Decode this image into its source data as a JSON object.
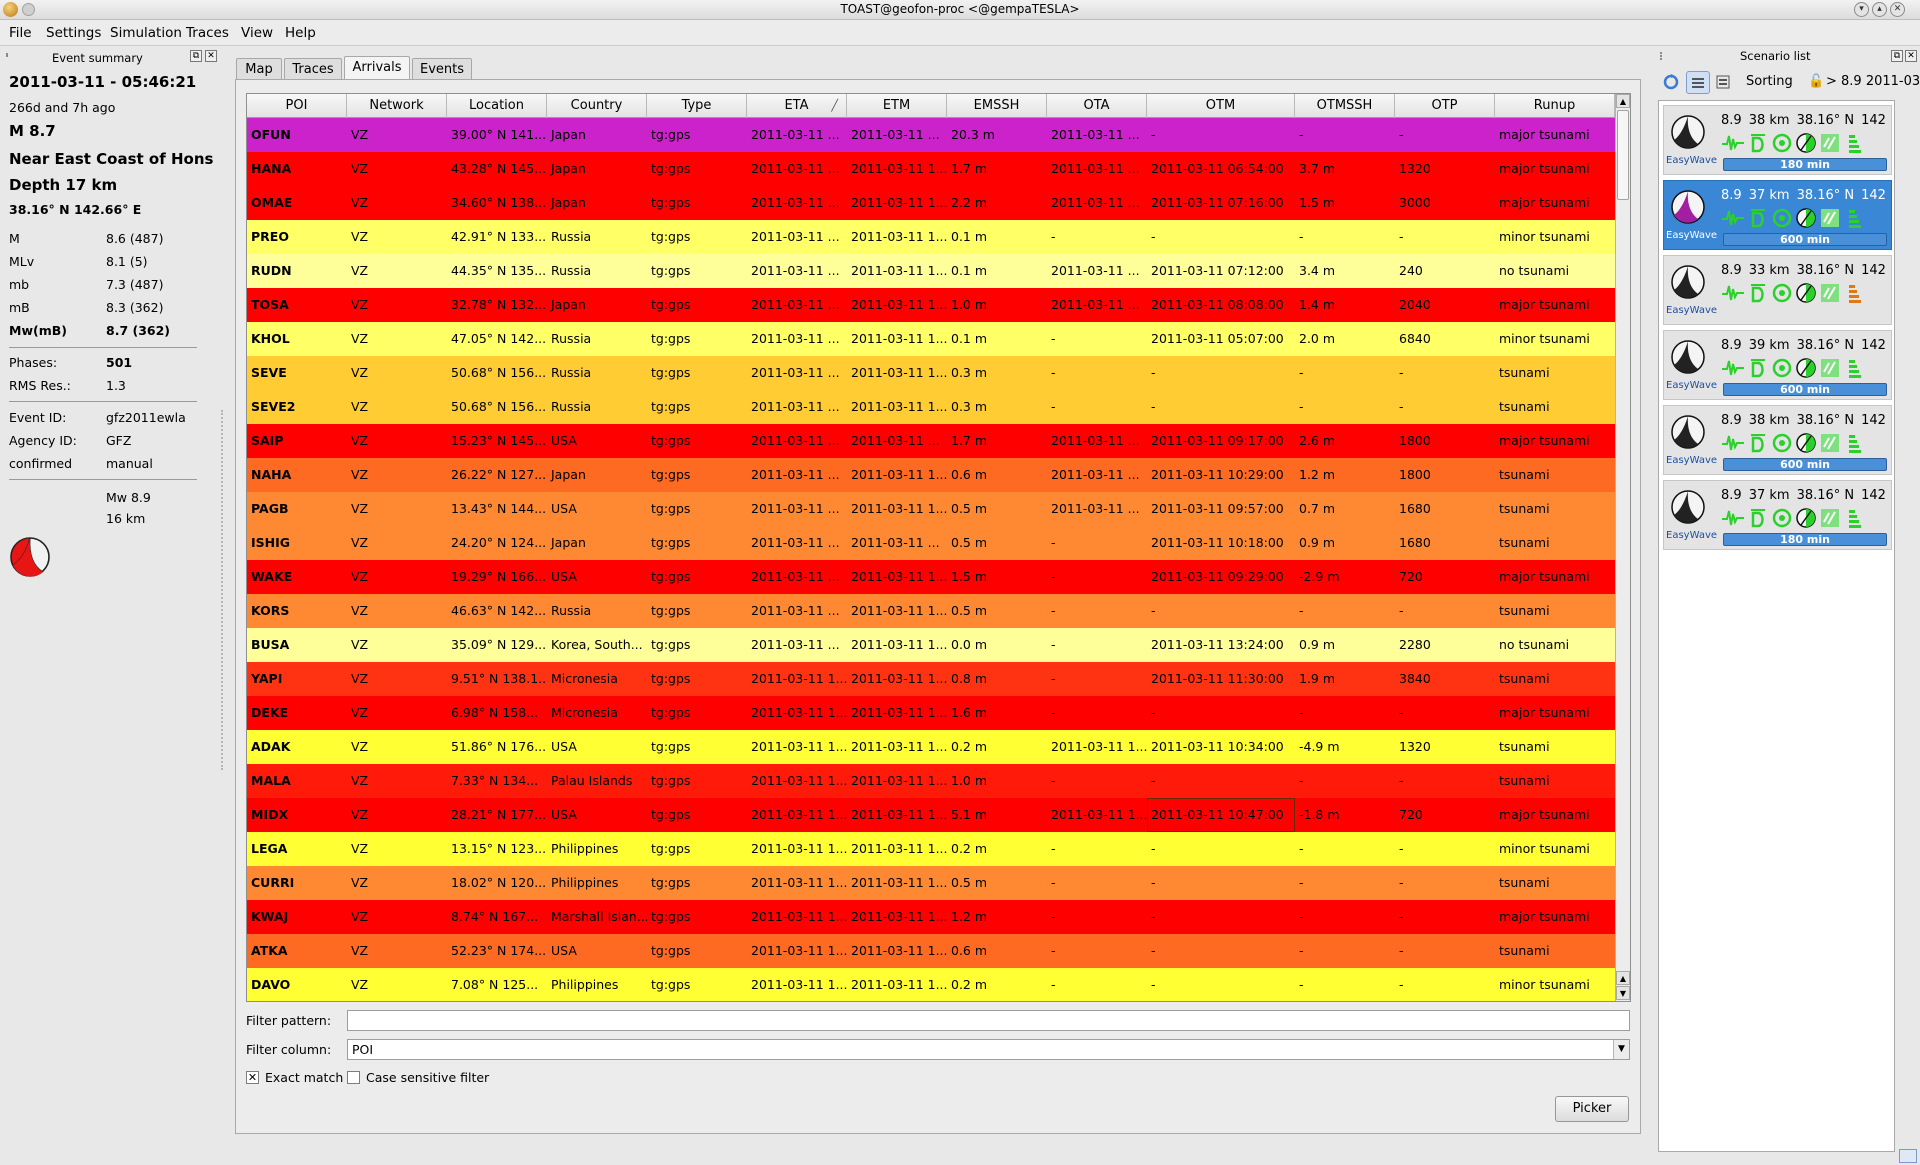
{
  "window": {
    "title": "TOAST@geofon-proc <@gempaTESLA>"
  },
  "menu": [
    "File",
    "Settings",
    "Simulation",
    "Traces",
    "View",
    "Help"
  ],
  "event_summary": {
    "dock_title": "Event summary",
    "datetime": "2011-03-11 - 05:46:21",
    "ago": "266d and 7h ago",
    "magnitude": "M 8.7",
    "region": "Near East Coast of Honshu",
    "depth": "Depth 17 km",
    "coords": "38.16° N  142.66° E",
    "mags": [
      {
        "label": "M",
        "value": "8.6 (487)"
      },
      {
        "label": "MLv",
        "value": "8.1 (5)"
      },
      {
        "label": "mb",
        "value": "7.3 (487)"
      },
      {
        "label": "mB",
        "value": "8.3 (362)"
      },
      {
        "label": "Mw(mB)",
        "value": "8.7 (362)"
      }
    ],
    "phases_label": "Phases:",
    "phases": "501",
    "rms_label": "RMS Res.:",
    "rms": "1.3",
    "event_id_label": "Event ID:",
    "event_id": "gfz2011ewla",
    "agency_label": "Agency ID:",
    "agency": "GFZ",
    "status_label": "confirmed",
    "status": "manual",
    "mech_mw": "Mw 8.9",
    "mech_depth": "16 km"
  },
  "tabs": [
    "Map",
    "Traces",
    "Arrivals",
    "Events"
  ],
  "table": {
    "columns": [
      "POI",
      "Network",
      "Location",
      "Country",
      "Type",
      "ETA",
      "ETM",
      "EMSSH",
      "OTA",
      "OTM",
      "OTMSSH",
      "OTP",
      "Runup"
    ],
    "rows": [
      {
        "bg": "#cc22cc",
        "cells": [
          "OFUN",
          "VZ",
          "39.00° N 141...",
          "Japan",
          "tg:gps",
          "2011-03-11 ...",
          "2011-03-11 ...",
          "20.3 m",
          "2011-03-11 ...",
          "-",
          "-",
          "-",
          "major tsunami"
        ]
      },
      {
        "bg": "#ff0000",
        "cells": [
          "HANA",
          "VZ",
          "43.28° N 145...",
          "Japan",
          "tg:gps",
          "2011-03-11 ...",
          "2011-03-11 1...",
          "1.7 m",
          "2011-03-11 ...",
          "2011-03-11 06:54:00",
          "3.7 m",
          "1320",
          "major tsunami"
        ]
      },
      {
        "bg": "#ff0000",
        "cells": [
          "OMAE",
          "VZ",
          "34.60° N 138...",
          "Japan",
          "tg:gps",
          "2011-03-11 ...",
          "2011-03-11 1...",
          "2.2 m",
          "2011-03-11 ...",
          "2011-03-11 07:16:00",
          "1.5 m",
          "3000",
          "major tsunami"
        ]
      },
      {
        "bg": "#ffff66",
        "cells": [
          "PREO",
          "VZ",
          "42.91° N 133...",
          "Russia",
          "tg:gps",
          "2011-03-11 ...",
          "2011-03-11 1...",
          "0.1 m",
          "-",
          "-",
          "-",
          "-",
          "minor tsunami"
        ]
      },
      {
        "bg": "#ffff99",
        "cells": [
          "RUDN",
          "VZ",
          "44.35° N 135...",
          "Russia",
          "tg:gps",
          "2011-03-11 ...",
          "2011-03-11 1...",
          "0.1 m",
          "2011-03-11 ...",
          "2011-03-11 07:12:00",
          "3.4 m",
          "240",
          "no tsunami"
        ]
      },
      {
        "bg": "#ff0000",
        "cells": [
          "TOSA",
          "VZ",
          "32.78° N 132...",
          "Japan",
          "tg:gps",
          "2011-03-11 ...",
          "2011-03-11 1...",
          "1.0 m",
          "2011-03-11 ...",
          "2011-03-11 08:08:00",
          "1.4 m",
          "2040",
          "major tsunami"
        ]
      },
      {
        "bg": "#ffff66",
        "cells": [
          "KHOL",
          "VZ",
          "47.05° N 142...",
          "Russia",
          "tg:gps",
          "2011-03-11 ...",
          "2011-03-11 1...",
          "0.1 m",
          "-",
          "2011-03-11 05:07:00",
          "2.0 m",
          "6840",
          "minor tsunami"
        ]
      },
      {
        "bg": "#ffcc33",
        "cells": [
          "SEVE",
          "VZ",
          "50.68° N 156...",
          "Russia",
          "tg:gps",
          "2011-03-11 ...",
          "2011-03-11 1...",
          "0.3 m",
          "-",
          "-",
          "-",
          "-",
          "tsunami"
        ]
      },
      {
        "bg": "#ffcc33",
        "cells": [
          "SEVE2",
          "VZ",
          "50.68° N 156...",
          "Russia",
          "tg:gps",
          "2011-03-11 ...",
          "2011-03-11 1...",
          "0.3 m",
          "-",
          "-",
          "-",
          "-",
          "tsunami"
        ]
      },
      {
        "bg": "#ff0000",
        "cells": [
          "SAIP",
          "VZ",
          "15.23° N 145...",
          "USA",
          "tg:gps",
          "2011-03-11 ...",
          "2011-03-11 ...",
          "1.7 m",
          "2011-03-11 ...",
          "2011-03-11 09:17:00",
          "2.6 m",
          "1800",
          "major tsunami"
        ]
      },
      {
        "bg": "#ff6a22",
        "cells": [
          "NAHA",
          "VZ",
          "26.22° N 127...",
          "Japan",
          "tg:gps",
          "2011-03-11 ...",
          "2011-03-11 1...",
          "0.6 m",
          "2011-03-11 ...",
          "2011-03-11 10:29:00",
          "1.2 m",
          "1800",
          "tsunami"
        ]
      },
      {
        "bg": "#ff8833",
        "cells": [
          "PAGB",
          "VZ",
          "13.43° N 144...",
          "USA",
          "tg:gps",
          "2011-03-11 ...",
          "2011-03-11 1...",
          "0.5 m",
          "2011-03-11 ...",
          "2011-03-11 09:57:00",
          "0.7 m",
          "1680",
          "tsunami"
        ]
      },
      {
        "bg": "#ff8833",
        "cells": [
          "ISHIG",
          "VZ",
          "24.20° N 124...",
          "Japan",
          "tg:gps",
          "2011-03-11 ...",
          "2011-03-11 ...",
          "0.5 m",
          "-",
          "2011-03-11 10:18:00",
          "0.9 m",
          "1680",
          "tsunami"
        ]
      },
      {
        "bg": "#ff0000",
        "cells": [
          "WAKE",
          "VZ",
          "19.29° N 166...",
          "USA",
          "tg:gps",
          "2011-03-11 ...",
          "2011-03-11 1...",
          "1.5 m",
          "-",
          "2011-03-11 09:29:00",
          "-2.9 m",
          "720",
          "major tsunami"
        ]
      },
      {
        "bg": "#ff8833",
        "cells": [
          "KORS",
          "VZ",
          "46.63° N 142...",
          "Russia",
          "tg:gps",
          "2011-03-11 ...",
          "2011-03-11 1...",
          "0.5 m",
          "-",
          "-",
          "-",
          "-",
          "tsunami"
        ]
      },
      {
        "bg": "#ffff99",
        "cells": [
          "BUSA",
          "VZ",
          "35.09° N 129...",
          "Korea, South...",
          "tg:gps",
          "2011-03-11 ...",
          "2011-03-11 1...",
          "0.0 m",
          "-",
          "2011-03-11 13:24:00",
          "0.9 m",
          "2280",
          "no tsunami"
        ]
      },
      {
        "bg": "#ff3311",
        "cells": [
          "YAPI",
          "VZ",
          "9.51° N 138.1...",
          "Micronesia",
          "tg:gps",
          "2011-03-11 1...",
          "2011-03-11 1...",
          "0.8 m",
          "-",
          "2011-03-11 11:30:00",
          "1.9 m",
          "3840",
          "tsunami"
        ]
      },
      {
        "bg": "#ff0000",
        "cells": [
          "DEKE",
          "VZ",
          "6.98° N 158...",
          "Micronesia",
          "tg:gps",
          "2011-03-11 1...",
          "2011-03-11 1...",
          "1.6 m",
          "-",
          "-",
          "-",
          "-",
          "major tsunami"
        ]
      },
      {
        "bg": "#ffff33",
        "cells": [
          "ADAK",
          "VZ",
          "51.86° N 176...",
          "USA",
          "tg:gps",
          "2011-03-11 1...",
          "2011-03-11 1...",
          "0.2 m",
          "2011-03-11 1...",
          "2011-03-11 10:34:00",
          "-4.9 m",
          "1320",
          "tsunami"
        ]
      },
      {
        "bg": "#ff1a0a",
        "cells": [
          "MALA",
          "VZ",
          "7.33° N 134...",
          "Palau Islands",
          "tg:gps",
          "2011-03-11 1...",
          "2011-03-11 1...",
          "1.0 m",
          "-",
          "-",
          "-",
          "-",
          "tsunami"
        ]
      },
      {
        "bg": "#ff0000",
        "cells": [
          "MIDX",
          "VZ",
          "28.21° N 177...",
          "USA",
          "tg:gps",
          "2011-03-11 1...",
          "2011-03-11 1...",
          "5.1 m",
          "2011-03-11 1...",
          "2011-03-11 10:47:00",
          "-1.8 m",
          "720",
          "major tsunami"
        ]
      },
      {
        "bg": "#ffff33",
        "cells": [
          "LEGA",
          "VZ",
          "13.15° N 123...",
          "Philippines",
          "tg:gps",
          "2011-03-11 1...",
          "2011-03-11 1...",
          "0.2 m",
          "-",
          "-",
          "-",
          "-",
          "minor tsunami"
        ]
      },
      {
        "bg": "#ff8833",
        "cells": [
          "CURRI",
          "VZ",
          "18.02° N 120...",
          "Philippines",
          "tg:gps",
          "2011-03-11 1...",
          "2011-03-11 1...",
          "0.5 m",
          "-",
          "-",
          "-",
          "-",
          "tsunami"
        ]
      },
      {
        "bg": "#ff0000",
        "cells": [
          "KWAJ",
          "VZ",
          "8.74° N 167...",
          "Marshall Islan...",
          "tg:gps",
          "2011-03-11 1...",
          "2011-03-11 1...",
          "1.2 m",
          "-",
          "-",
          "-",
          "-",
          "major tsunami"
        ]
      },
      {
        "bg": "#ff6a22",
        "cells": [
          "ATKA",
          "VZ",
          "52.23° N 174...",
          "USA",
          "tg:gps",
          "2011-03-11 1...",
          "2011-03-11 1...",
          "0.6 m",
          "-",
          "-",
          "-",
          "-",
          "tsunami"
        ]
      },
      {
        "bg": "#ffff33",
        "cells": [
          "DAVO",
          "VZ",
          "7.08° N 125...",
          "Philippines",
          "tg:gps",
          "2011-03-11 1...",
          "2011-03-11 1...",
          "0.2 m",
          "-",
          "-",
          "-",
          "-",
          "minor tsunami"
        ]
      }
    ]
  },
  "filter": {
    "pattern_label": "Filter pattern:",
    "pattern_value": "",
    "column_label": "Filter column:",
    "column_value": "POI",
    "exact_match_label": "Exact match",
    "exact_match_checked": "✕",
    "case_label": "Case sensitive filter",
    "picker_label": "Picker"
  },
  "scenario_list": {
    "dock_title": "Scenario list",
    "sorting_label": "Sorting",
    "current_label": "> 8.9 2011-03",
    "items": [
      {
        "mag": "8.9",
        "depth": "38 km",
        "lat": "38.16° N",
        "lon": "142",
        "method": "EasyWave",
        "duration": "180 min",
        "selected": false
      },
      {
        "mag": "8.9",
        "depth": "37 km",
        "lat": "38.16° N",
        "lon": "142",
        "method": "EasyWave",
        "duration": "600 min",
        "selected": true
      },
      {
        "mag": "8.9",
        "depth": "33 km",
        "lat": "38.16° N",
        "lon": "142",
        "method": "EasyWave",
        "duration": "",
        "selected": false
      },
      {
        "mag": "8.9",
        "depth": "39 km",
        "lat": "38.16° N",
        "lon": "142",
        "method": "EasyWave",
        "duration": "600 min",
        "selected": false
      },
      {
        "mag": "8.9",
        "depth": "38 km",
        "lat": "38.16° N",
        "lon": "142",
        "method": "EasyWave",
        "duration": "600 min",
        "selected": false
      },
      {
        "mag": "8.9",
        "depth": "37 km",
        "lat": "38.16° N",
        "lon": "142",
        "method": "EasyWave",
        "duration": "180 min",
        "selected": false
      }
    ]
  },
  "icons": {
    "beachball": "beachball-icon",
    "waveform": "waveform-icon",
    "d_badge": "d-icon",
    "target": "target-icon",
    "gauge": "gauge-icon",
    "check": "check-icon",
    "level": "level-icon"
  }
}
